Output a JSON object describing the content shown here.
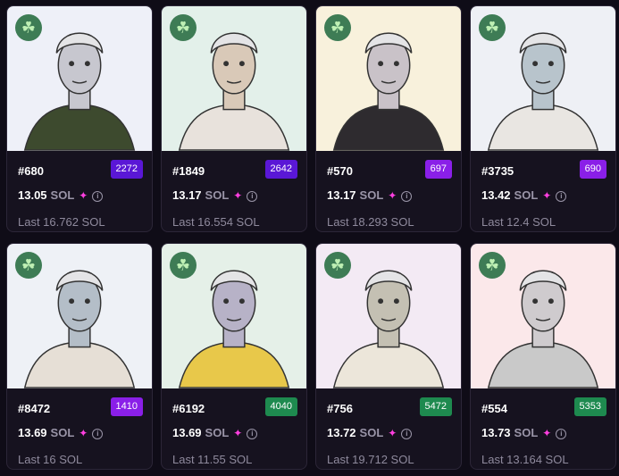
{
  "currency": "SOL",
  "icons": {
    "clover": "clover-icon",
    "sparkle": "sparkle-icon",
    "info": "info-icon"
  },
  "colors": {
    "background": "#0f0c17",
    "card": "#16121f",
    "rank_purple": "#7b1fe0",
    "rank_violet": "#5a17d6",
    "rank_green": "#1e8a4f",
    "sparkle": "#ff3fe0"
  },
  "cards": [
    {
      "id": "#680",
      "rank": "2272",
      "rank_color": "#5a17d6",
      "price": "13.05",
      "last": "Last 16.762 SOL",
      "bg": "#eef0f8"
    },
    {
      "id": "#1849",
      "rank": "2642",
      "rank_color": "#5a17d6",
      "price": "13.17",
      "last": "Last 16.554 SOL",
      "bg": "#e3f0ea"
    },
    {
      "id": "#570",
      "rank": "697",
      "rank_color": "#8a1fe8",
      "price": "13.17",
      "last": "Last 18.293 SOL",
      "bg": "#f8f1dc"
    },
    {
      "id": "#3735",
      "rank": "690",
      "rank_color": "#8a1fe8",
      "price": "13.42",
      "last": "Last 12.4 SOL",
      "bg": "#eef0f5"
    },
    {
      "id": "#8472",
      "rank": "1410",
      "rank_color": "#8a1fe8",
      "price": "13.69",
      "last": "Last 16 SOL",
      "bg": "#eef1f6"
    },
    {
      "id": "#6192",
      "rank": "4040",
      "rank_color": "#1e8a4f",
      "price": "13.69",
      "last": "Last 11.55 SOL",
      "bg": "#e5f0e8"
    },
    {
      "id": "#756",
      "rank": "5472",
      "rank_color": "#1e8a4f",
      "price": "13.72",
      "last": "Last 19.712 SOL",
      "bg": "#f3eaf4"
    },
    {
      "id": "#554",
      "rank": "5353",
      "rank_color": "#1e8a4f",
      "price": "13.73",
      "last": "Last 13.164 SOL",
      "bg": "#fbe8ea"
    }
  ]
}
